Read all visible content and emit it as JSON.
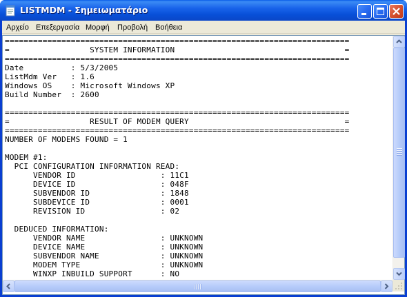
{
  "window": {
    "title": "LISTMDM - Σημειωματάριο",
    "app_icon": "notepad-icon",
    "controls": [
      "minimize-icon",
      "maximize-icon",
      "close-icon"
    ]
  },
  "menubar": {
    "items": [
      "Αρχείο",
      "Επεξεργασία",
      "Μορφή",
      "Προβολή",
      "Βοήθεια"
    ]
  },
  "document": {
    "lines": [
      "=========================================================================",
      "=                 SYSTEM INFORMATION                                    =",
      "=========================================================================",
      "Date          : 5/3/2005",
      "ListMdm Ver   : 1.6",
      "Windows OS    : Microsoft Windows XP",
      "Build Number  : 2600",
      "",
      "=========================================================================",
      "=                 RESULT OF MODEM QUERY                                 =",
      "=========================================================================",
      "NUMBER OF MODEMS FOUND = 1",
      "",
      "MODEM #1:",
      "  PCI CONFIGURATION INFORMATION READ:",
      "      VENDOR ID                  : 11C1",
      "      DEVICE ID                  : 048F",
      "      SUBVENDOR ID               : 1848",
      "      SUBDEVICE ID               : 0001",
      "      REVISION ID                : 02",
      "",
      "  DEDUCED INFORMATION:",
      "      VENDOR NAME                : UNKNOWN",
      "      DEVICE NAME                : UNKNOWN",
      "      SUBVENDOR NAME             : UNKNOWN",
      "      MODEM TYPE                 : UNKNOWN",
      "      WINXP INBUILD SUPPORT      : NO"
    ]
  },
  "colors": {
    "titlebar": "#0a5ce8",
    "menubar_bg": "#ece9d8",
    "close_button": "#d4512f",
    "text": "#000000"
  }
}
